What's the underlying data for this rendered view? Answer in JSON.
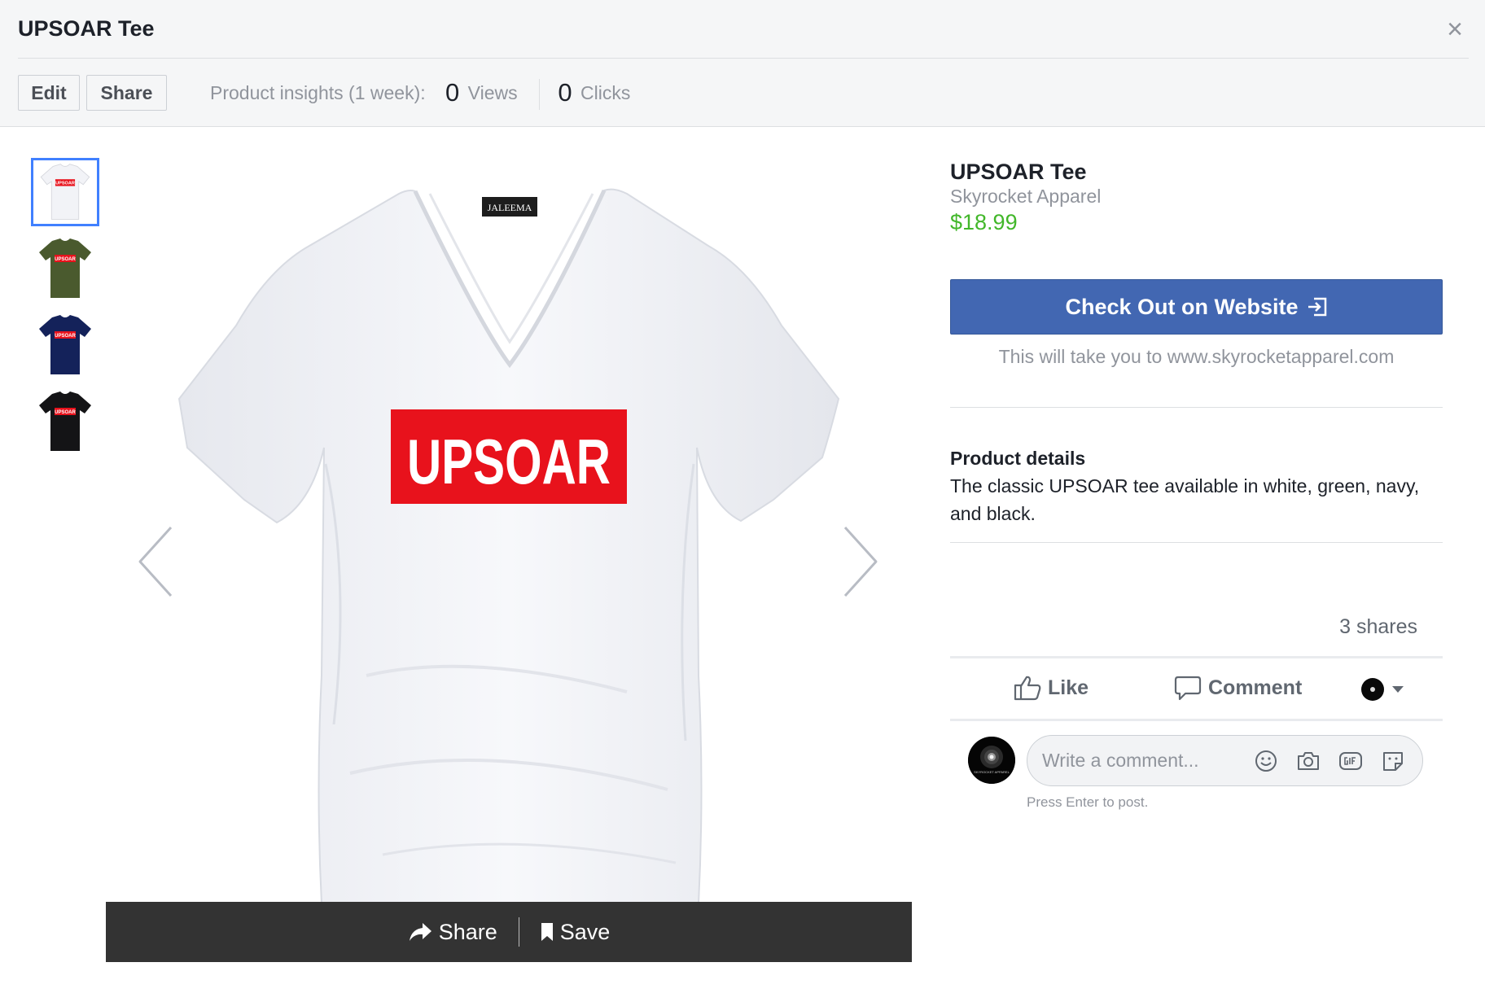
{
  "header": {
    "title": "UPSOAR Tee",
    "close_glyph": "×",
    "edit_label": "Edit",
    "share_label": "Share",
    "insights_label": "Product insights (1 week):",
    "views_count": "0",
    "views_label": "Views",
    "clicks_count": "0",
    "clicks_label": "Clicks"
  },
  "gallery": {
    "thumbnails": [
      {
        "color_name": "white",
        "shirt_color": "#f2f3f7",
        "selected": true
      },
      {
        "color_name": "green",
        "shirt_color": "#4a5a2e",
        "selected": false
      },
      {
        "color_name": "navy",
        "shirt_color": "#14225a",
        "selected": false
      },
      {
        "color_name": "black",
        "shirt_color": "#141416",
        "selected": false
      }
    ],
    "shirt_logo_text": "UPSOAR",
    "shirt_tag_text": "JALEEMA",
    "logo_color": "#e8121c",
    "image_bar": {
      "share_label": "Share",
      "save_label": "Save"
    }
  },
  "product": {
    "title": "UPSOAR Tee",
    "seller": "Skyrocket Apparel",
    "price": "$18.99",
    "checkout_label": "Check Out on Website",
    "checkout_note": "This will take you to www.skyrocketapparel.com",
    "details_heading": "Product details",
    "details_text": "The classic UPSOAR tee available in white, green, navy, and black."
  },
  "engagement": {
    "shares": "3 shares",
    "like_label": "Like",
    "comment_label": "Comment"
  },
  "comment": {
    "placeholder": "Write a comment...",
    "hint": "Press Enter to post.",
    "avatar_text": "SKYROCKET APPAREL"
  },
  "colors": {
    "brand_blue": "#4267b2",
    "price_green": "#42b72a",
    "selected_thumb_border": "#4080ff"
  }
}
